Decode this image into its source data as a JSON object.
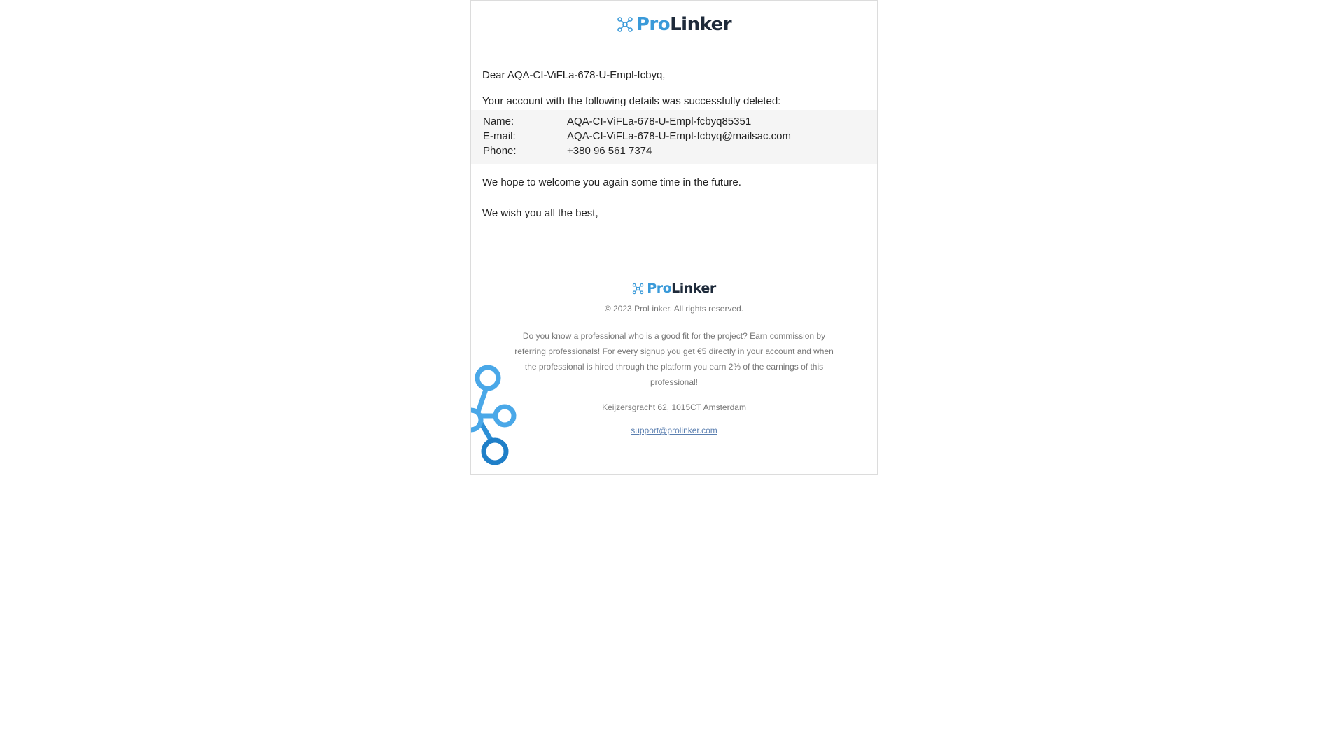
{
  "brand": {
    "name_part1": "Pro",
    "name_part2": "Linker",
    "color_primary": "#3a9ad9",
    "color_dark": "#1e2a3a"
  },
  "email": {
    "greeting": "Dear AQA-CI-ViFLa-678-U-Empl-fcbyq,",
    "intro": "Your account with the following details was successfully deleted:",
    "details": [
      {
        "label": "Name:",
        "value": "AQA-CI-ViFLa-678-U-Empl-fcbyq85351"
      },
      {
        "label": "E-mail:",
        "value": "AQA-CI-ViFLa-678-U-Empl-fcbyq@mailsac.com"
      },
      {
        "label": "Phone:",
        "value": "+380 96 561 7374"
      }
    ],
    "closing1": "We hope to welcome you again some time in the future.",
    "closing2": "We wish you all the best,"
  },
  "footer": {
    "copyright": "© 2023 ProLinker. All rights reserved.",
    "pitch": "Do you know a professional who is a good fit for the project? Earn commission by referring professionals! For every signup you get €5 directly in your account and when the professional is hired through the platform you earn 2% of the earnings of this professional!",
    "address": "Keijzersgracht 62, 1015CT Amsterdam",
    "support_email": "support@prolinker.com"
  }
}
